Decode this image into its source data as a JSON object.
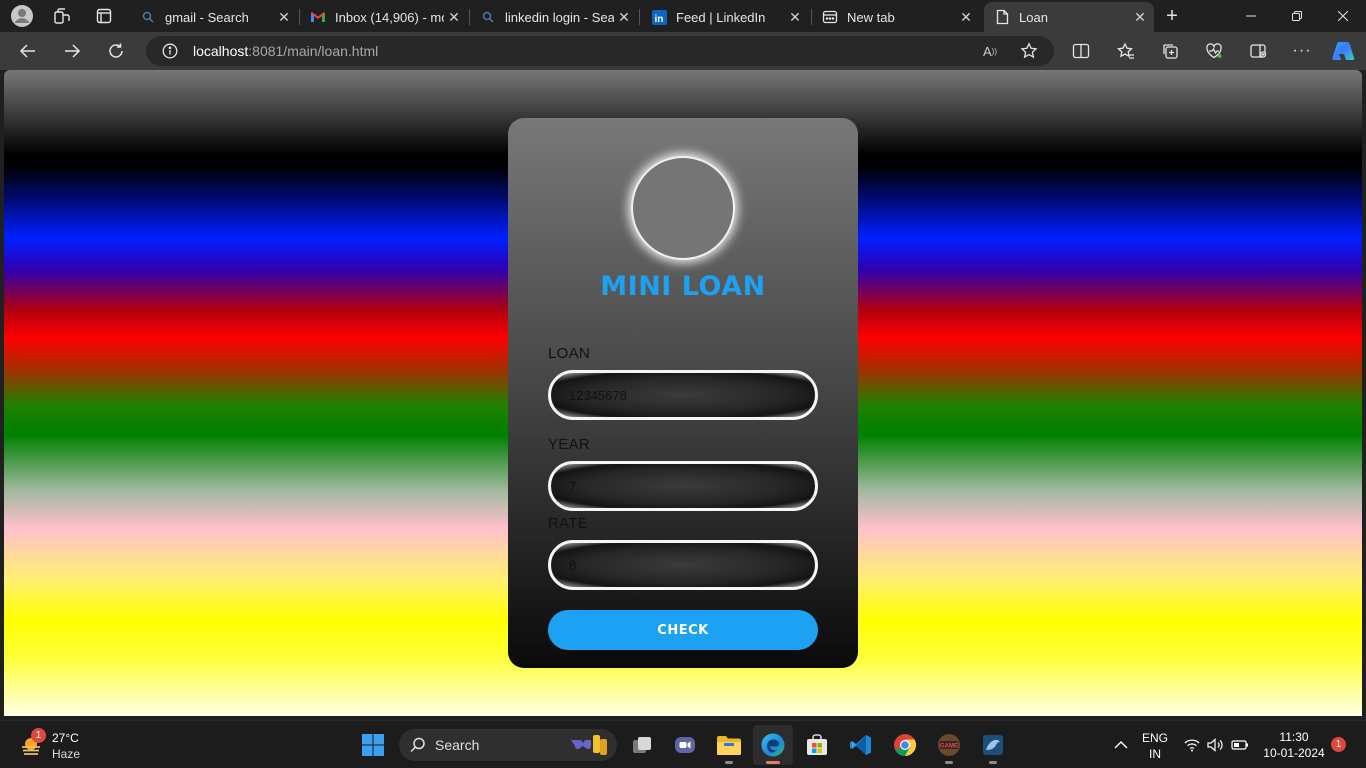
{
  "browser": {
    "tabs": [
      {
        "title": "gmail - Search"
      },
      {
        "title": "Inbox (14,906) - mol"
      },
      {
        "title": "linkedin login - Sear"
      },
      {
        "title": "Feed | LinkedIn"
      },
      {
        "title": "New tab"
      },
      {
        "title": "Loan"
      }
    ],
    "active_tab": "Loan",
    "url_host": "localhost",
    "url_rest": ":8081/main/loan.html"
  },
  "page": {
    "title": "MINI LOAN",
    "fields": [
      {
        "label": "LOAN",
        "value": "12345678"
      },
      {
        "label": "YEAR",
        "value": "7"
      },
      {
        "label": "RATE",
        "value": "8"
      }
    ],
    "button": "CHECK"
  },
  "taskbar": {
    "weather_temp": "27°C",
    "weather_cond": "Haze",
    "weather_badge": "1",
    "search_label": "Search",
    "lang_top": "ENG",
    "lang_bottom": "IN",
    "time": "11:30",
    "date": "10-01-2024",
    "notification_count": "1"
  },
  "colors": {
    "accent": "#1da1f2",
    "browser_bg": "#202020",
    "toolbar_bg": "#3b3b3b"
  }
}
